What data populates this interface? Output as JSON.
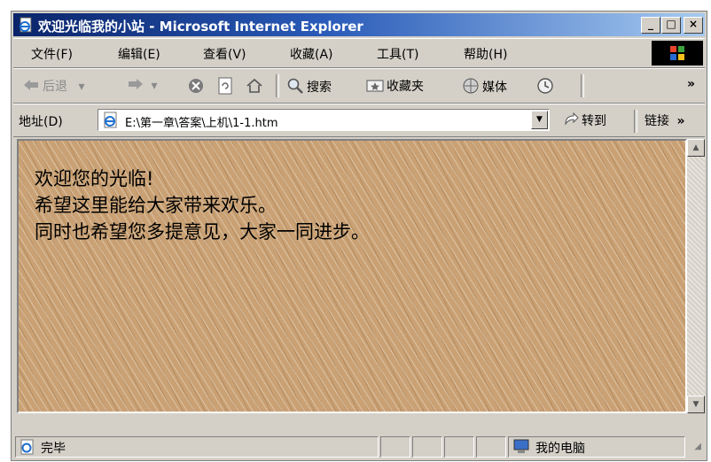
{
  "window": {
    "title": "欢迎光临我的小站 - Microsoft Internet Explorer",
    "controls": [
      "_",
      "□",
      "×"
    ]
  },
  "menu": {
    "items": [
      "文件(F)",
      "编辑(E)",
      "查看(V)",
      "收藏(A)",
      "工具(T)",
      "帮助(H)"
    ]
  },
  "toolbar": {
    "back": "后退",
    "search": "搜索",
    "favorites": "收藏夹",
    "media": "媒体",
    "more": "»"
  },
  "address": {
    "label": "地址(D)",
    "value": "E:\\第一章\\答案\\上机\\1-1.htm",
    "go": "转到",
    "links": "链接",
    "more": "»"
  },
  "page": {
    "lines": [
      "欢迎您的光临!",
      "希望这里能给大家带来欢乐。",
      "同时也希望您多提意见，大家一同进步。"
    ]
  },
  "status": {
    "text": "完毕",
    "zone": "我的电脑"
  }
}
